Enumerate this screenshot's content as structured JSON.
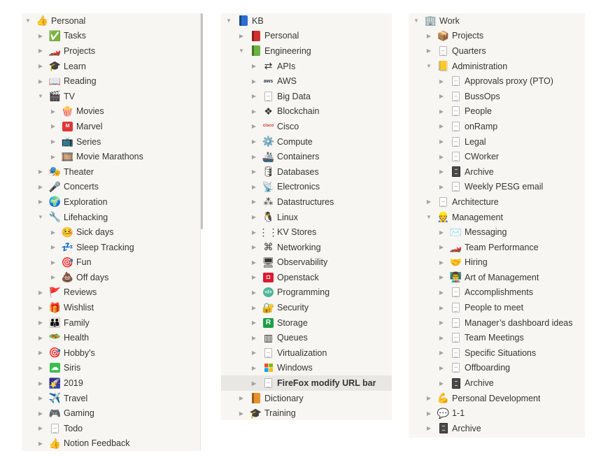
{
  "colors": {
    "panel_bg": "#f7f6f3",
    "text": "#37352f",
    "toggle": "#a5a4a1",
    "selected_bg": "#e8e7e4"
  },
  "panels": {
    "personal": {
      "rows": [
        {
          "label": "Personal",
          "icon": "thumbs-up-icon",
          "glyph": "👍",
          "depth": 0,
          "expanded": true
        },
        {
          "label": "Tasks",
          "icon": "check-mark-button-icon",
          "glyph": "✅",
          "depth": 1,
          "expanded": false
        },
        {
          "label": "Projects",
          "icon": "racing-car-icon",
          "glyph": "🏎️",
          "depth": 1,
          "expanded": false
        },
        {
          "label": "Learn",
          "icon": "graduation-cap-icon",
          "glyph": "🎓",
          "depth": 1,
          "expanded": false
        },
        {
          "label": "Reading",
          "icon": "open-book-icon",
          "glyph": "📖",
          "depth": 1,
          "expanded": false
        },
        {
          "label": "TV",
          "icon": "clapper-board-icon",
          "glyph": "🎬",
          "depth": 1,
          "expanded": true
        },
        {
          "label": "Movies",
          "icon": "popcorn-icon",
          "glyph": "🍿",
          "depth": 2,
          "expanded": false
        },
        {
          "label": "Marvel",
          "icon": "marvel-logo-icon",
          "glyph": "M",
          "depth": 2,
          "expanded": false
        },
        {
          "label": "Series",
          "icon": "television-icon",
          "glyph": "📺",
          "depth": 2,
          "expanded": false
        },
        {
          "label": "Movie Marathons",
          "icon": "film-reel-box-icon",
          "glyph": "🎞️",
          "depth": 2,
          "expanded": false
        },
        {
          "label": "Theater",
          "icon": "performing-arts-icon",
          "glyph": "🎭",
          "depth": 1,
          "expanded": false
        },
        {
          "label": "Concerts",
          "icon": "microphone-icon",
          "glyph": "🎤",
          "depth": 1,
          "expanded": false
        },
        {
          "label": "Exploration",
          "icon": "globe-icon",
          "glyph": "🌍",
          "depth": 1,
          "expanded": false
        },
        {
          "label": "Lifehacking",
          "icon": "wrench-icon",
          "glyph": "🔧",
          "depth": 1,
          "expanded": true
        },
        {
          "label": "Sick days",
          "icon": "face-with-thermometer-icon",
          "glyph": "🤒",
          "depth": 2,
          "expanded": false
        },
        {
          "label": "Sleep Tracking",
          "icon": "zzz-icon",
          "glyph": "💤",
          "depth": 2,
          "expanded": false
        },
        {
          "label": "Fun",
          "icon": "direct-hit-icon",
          "glyph": "🎯",
          "depth": 2,
          "expanded": false
        },
        {
          "label": "Off days",
          "icon": "pile-of-poo-icon",
          "glyph": "💩",
          "depth": 2,
          "expanded": false
        },
        {
          "label": "Reviews",
          "icon": "triangular-flag-icon",
          "glyph": "🚩",
          "depth": 1,
          "expanded": false
        },
        {
          "label": "Wishlist",
          "icon": "wrapped-gift-icon",
          "glyph": "🎁",
          "depth": 1,
          "expanded": false
        },
        {
          "label": "Family",
          "icon": "family-icon",
          "glyph": "👪",
          "depth": 1,
          "expanded": false
        },
        {
          "label": "Health",
          "icon": "salad-icon",
          "glyph": "🥗",
          "depth": 1,
          "expanded": false
        },
        {
          "label": "Hobby's",
          "icon": "direct-hit-icon",
          "glyph": "🎯",
          "depth": 1,
          "expanded": false
        },
        {
          "label": "Siris",
          "icon": "siri-cloud-icon",
          "glyph": "☁",
          "depth": 1,
          "expanded": false
        },
        {
          "label": "2019",
          "icon": "star-picture-icon",
          "glyph": "🌠",
          "depth": 1,
          "expanded": false
        },
        {
          "label": "Travel",
          "icon": "airplane-icon",
          "glyph": "✈️",
          "depth": 1,
          "expanded": false
        },
        {
          "label": "Gaming",
          "icon": "game-controller-icon",
          "glyph": "🎮",
          "depth": 1,
          "expanded": false
        },
        {
          "label": "Todo",
          "icon": "page-icon",
          "glyph": "",
          "depth": 1,
          "expanded": false
        },
        {
          "label": "Notion Feedback",
          "icon": "thumbs-up-icon",
          "glyph": "👍",
          "depth": 1,
          "expanded": false
        }
      ]
    },
    "kb": {
      "rows": [
        {
          "label": "KB",
          "icon": "blue-book-icon",
          "glyph": "",
          "depth": 0,
          "expanded": true
        },
        {
          "label": "Personal",
          "icon": "red-book-icon",
          "glyph": "",
          "depth": 1,
          "expanded": false
        },
        {
          "label": "Engineering",
          "icon": "green-book-icon",
          "glyph": "",
          "depth": 1,
          "expanded": true
        },
        {
          "label": "APIs",
          "icon": "api-arrows-icon",
          "glyph": "⇄",
          "depth": 2,
          "expanded": false
        },
        {
          "label": "AWS",
          "icon": "aws-logo-icon",
          "glyph": "aws",
          "depth": 2,
          "expanded": false
        },
        {
          "label": "Big Data",
          "icon": "page-icon",
          "glyph": "",
          "depth": 2,
          "expanded": false
        },
        {
          "label": "Blockchain",
          "icon": "blockchain-logo-icon",
          "glyph": "❖",
          "depth": 2,
          "expanded": false
        },
        {
          "label": "Cisco",
          "icon": "cisco-logo-icon",
          "glyph": "cisco",
          "depth": 2,
          "expanded": false
        },
        {
          "label": "Compute",
          "icon": "gear-icon",
          "glyph": "⚙️",
          "depth": 2,
          "expanded": false
        },
        {
          "label": "Containers",
          "icon": "ship-icon",
          "glyph": "🚢",
          "depth": 2,
          "expanded": false
        },
        {
          "label": "Databases",
          "icon": "database-icon",
          "glyph": "🛢",
          "depth": 2,
          "expanded": false
        },
        {
          "label": "Electronics",
          "icon": "satellite-dish-icon",
          "glyph": "📡",
          "depth": 2,
          "expanded": false
        },
        {
          "label": "Datastructures",
          "icon": "tree-structure-icon",
          "glyph": "⁂",
          "depth": 2,
          "expanded": false
        },
        {
          "label": "Linux",
          "icon": "penguin-icon",
          "glyph": "🐧",
          "depth": 2,
          "expanded": false
        },
        {
          "label": "KV Stores",
          "icon": "key-value-icon",
          "glyph": "⋮⋮",
          "depth": 2,
          "expanded": false
        },
        {
          "label": "Networking",
          "icon": "network-nodes-icon",
          "glyph": "⌘",
          "depth": 2,
          "expanded": false
        },
        {
          "label": "Observability",
          "icon": "monitor-chart-icon",
          "glyph": "🖥",
          "depth": 2,
          "expanded": false
        },
        {
          "label": "Openstack",
          "icon": "openstack-logo-icon",
          "glyph": "◘",
          "depth": 2,
          "expanded": false
        },
        {
          "label": "Programming",
          "icon": "code-icon",
          "glyph": "</>",
          "depth": 2,
          "expanded": false
        },
        {
          "label": "Security",
          "icon": "locked-with-key-icon",
          "glyph": "🔐",
          "depth": 2,
          "expanded": false
        },
        {
          "label": "Storage",
          "icon": "storage-icon",
          "glyph": "R",
          "depth": 2,
          "expanded": false
        },
        {
          "label": "Queues",
          "icon": "queue-icon",
          "glyph": "▥",
          "depth": 2,
          "expanded": false
        },
        {
          "label": "Virtualization",
          "icon": "page-icon",
          "glyph": "",
          "depth": 2,
          "expanded": false
        },
        {
          "label": "Windows",
          "icon": "windows-logo-icon",
          "glyph": "",
          "depth": 2,
          "expanded": false
        },
        {
          "label": "FireFox modify URL bar",
          "icon": "page-icon",
          "glyph": "",
          "depth": 2,
          "expanded": false,
          "selected": true
        },
        {
          "label": "Dictionary",
          "icon": "orange-book-icon",
          "glyph": "",
          "depth": 1,
          "expanded": false
        },
        {
          "label": "Training",
          "icon": "graduation-cap-icon",
          "glyph": "🎓",
          "depth": 1,
          "expanded": false
        }
      ]
    },
    "work": {
      "rows": [
        {
          "label": "Work",
          "icon": "office-building-icon",
          "glyph": "🏢",
          "depth": 0,
          "expanded": true
        },
        {
          "label": "Projects",
          "icon": "package-icon",
          "glyph": "📦",
          "depth": 1,
          "expanded": false
        },
        {
          "label": "Quarters",
          "icon": "page-icon",
          "glyph": "",
          "depth": 1,
          "expanded": false
        },
        {
          "label": "Administration",
          "icon": "ledger-icon",
          "glyph": "📒",
          "depth": 1,
          "expanded": true
        },
        {
          "label": "Approvals proxy (PTO)",
          "icon": "page-icon",
          "glyph": "",
          "depth": 2,
          "expanded": false
        },
        {
          "label": "BussOps",
          "icon": "page-icon",
          "glyph": "",
          "depth": 2,
          "expanded": false
        },
        {
          "label": "People",
          "icon": "page-icon",
          "glyph": "",
          "depth": 2,
          "expanded": false
        },
        {
          "label": "onRamp",
          "icon": "page-icon",
          "glyph": "",
          "depth": 2,
          "expanded": false
        },
        {
          "label": "Legal",
          "icon": "page-icon",
          "glyph": "",
          "depth": 2,
          "expanded": false
        },
        {
          "label": "CWorker",
          "icon": "page-icon",
          "glyph": "",
          "depth": 2,
          "expanded": false
        },
        {
          "label": "Archive",
          "icon": "file-cabinet-icon",
          "glyph": "",
          "depth": 2,
          "expanded": false
        },
        {
          "label": "Weekly PESG email",
          "icon": "page-icon",
          "glyph": "",
          "depth": 2,
          "expanded": false
        },
        {
          "label": "Architecture",
          "icon": "page-icon",
          "glyph": "",
          "depth": 1,
          "expanded": false
        },
        {
          "label": "Management",
          "icon": "technologist-icon",
          "glyph": "👷",
          "depth": 1,
          "expanded": true
        },
        {
          "label": "Messaging",
          "icon": "envelope-icon",
          "glyph": "✉️",
          "depth": 2,
          "expanded": false
        },
        {
          "label": "Team Performance",
          "icon": "racing-car-icon",
          "glyph": "🏎️",
          "depth": 2,
          "expanded": false
        },
        {
          "label": "Hiring",
          "icon": "handshake-icon",
          "glyph": "🤝",
          "depth": 2,
          "expanded": false
        },
        {
          "label": "Art of Management",
          "icon": "teacher-icon",
          "glyph": "👨‍🏫",
          "depth": 2,
          "expanded": false
        },
        {
          "label": "Accomplishments",
          "icon": "page-icon",
          "glyph": "",
          "depth": 2,
          "expanded": false
        },
        {
          "label": "People to meet",
          "icon": "page-icon",
          "glyph": "",
          "depth": 2,
          "expanded": false
        },
        {
          "label": "Manager’s dashboard ideas",
          "icon": "page-icon",
          "glyph": "",
          "depth": 2,
          "expanded": false
        },
        {
          "label": "Team Meetings",
          "icon": "page-icon",
          "glyph": "",
          "depth": 2,
          "expanded": false
        },
        {
          "label": "Specific Situations",
          "icon": "page-icon",
          "glyph": "",
          "depth": 2,
          "expanded": false
        },
        {
          "label": "Offboarding",
          "icon": "page-icon",
          "glyph": "",
          "depth": 2,
          "expanded": false
        },
        {
          "label": "Archive",
          "icon": "file-cabinet-icon",
          "glyph": "",
          "depth": 2,
          "expanded": false
        },
        {
          "label": "Personal Development",
          "icon": "flexed-biceps-icon",
          "glyph": "💪",
          "depth": 1,
          "expanded": false
        },
        {
          "label": "1-1",
          "icon": "speech-balloon-icon",
          "glyph": "💬",
          "depth": 1,
          "expanded": false
        },
        {
          "label": "Archive",
          "icon": "file-cabinet-icon",
          "glyph": "",
          "depth": 1,
          "expanded": false
        }
      ]
    }
  }
}
